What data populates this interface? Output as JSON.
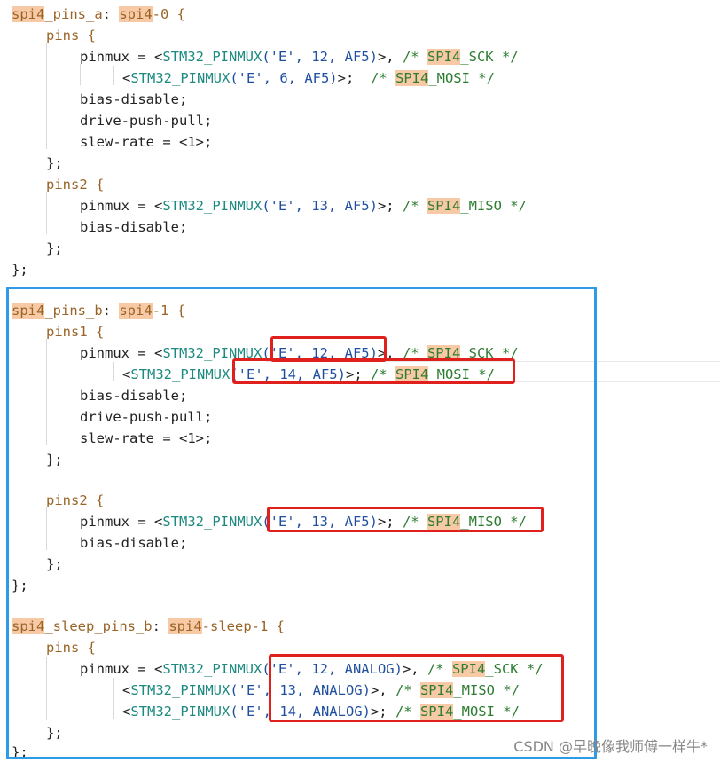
{
  "code": {
    "block_a": {
      "node_label": "spi4",
      "node_suffix": "_pins_a",
      "colon": ": ",
      "ref_hl": "spi4",
      "ref_rest": "-0 {",
      "pins_name": "pins {",
      "pinmux_prefix": "pinmux = <",
      "macro": "STM32_PINMUX",
      "l1_args": "('E', 12, AF5)",
      "l1_tail": ">, ",
      "cm_open": "/* ",
      "spi4": "SPI4",
      "sck": "_SCK */",
      "l2_args": "('E', 6, AF5)",
      "l2_tail": ">;  ",
      "mosi": "_MOSI */",
      "bias_disable": "bias-disable;",
      "drive_push_pull": "drive-push-pull;",
      "slew_rate": "slew-rate = <1>;",
      "close_inner": "};",
      "pins2_name": "pins2 {",
      "l3_args": "('E', 13, AF5)",
      "l3_tail": ">; ",
      "miso": "_MISO */",
      "close_outer": "};"
    },
    "block_b": {
      "node_label": "spi4",
      "node_suffix": "_pins_b",
      "ref_rest": "-1 {",
      "pins1_name": "pins1 {",
      "l1_args": "('E', 12, AF5)",
      "l2_args": "('E', 14, AF5)",
      "l2_tail": ">; ",
      "pins2_name": "pins2 {",
      "l3_args": "('E', 13, AF5)"
    },
    "block_c": {
      "node_label": "spi4",
      "node_suffix": "_sleep_pins_b",
      "ref_rest": "-sleep-1 {",
      "pins_name": "pins {",
      "l1_args": "('E', 12, ANALOG)",
      "l2_args": "('E', 13, ANALOG)",
      "l2_tail": ">, ",
      "l3_args": "('E', 14, ANALOG)",
      "l3_tail": ">; "
    }
  },
  "watermark": "CSDN @早晚像我师傅一样牛*"
}
